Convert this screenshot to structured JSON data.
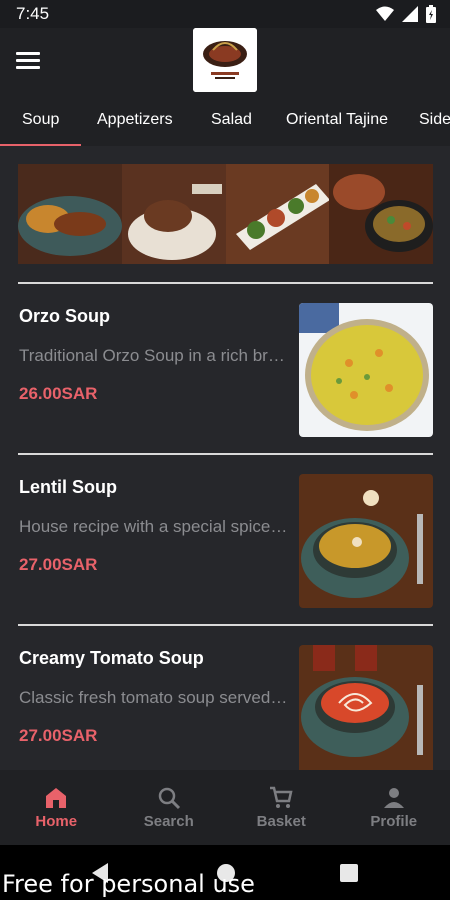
{
  "status_bar": {
    "time": "7:45"
  },
  "tabs": [
    {
      "label": "Soup",
      "active": true
    },
    {
      "label": "Appetizers",
      "active": false
    },
    {
      "label": "Salad",
      "active": false
    },
    {
      "label": "Oriental Tajine",
      "active": false
    },
    {
      "label": "Side",
      "active": false
    }
  ],
  "menu_items": [
    {
      "name": "Orzo Soup",
      "description": "Traditional Orzo Soup in a rich broth",
      "price": "26.00SAR"
    },
    {
      "name": "Lentil Soup",
      "description": "House recipe with a special spice blend",
      "price": "27.00SAR"
    },
    {
      "name": "Creamy Tomato Soup",
      "description": "Classic fresh tomato soup served hot",
      "price": "27.00SAR"
    }
  ],
  "bottom_nav": [
    {
      "label": "Home",
      "icon": "home-icon",
      "active": true
    },
    {
      "label": "Search",
      "icon": "search-icon",
      "active": false
    },
    {
      "label": "Basket",
      "icon": "cart-icon",
      "active": false
    },
    {
      "label": "Profile",
      "icon": "person-icon",
      "active": false
    }
  ],
  "watermark": "Free for personal use",
  "colors": {
    "accent": "#e8626a",
    "background": "#26272b",
    "bar": "#202124"
  }
}
